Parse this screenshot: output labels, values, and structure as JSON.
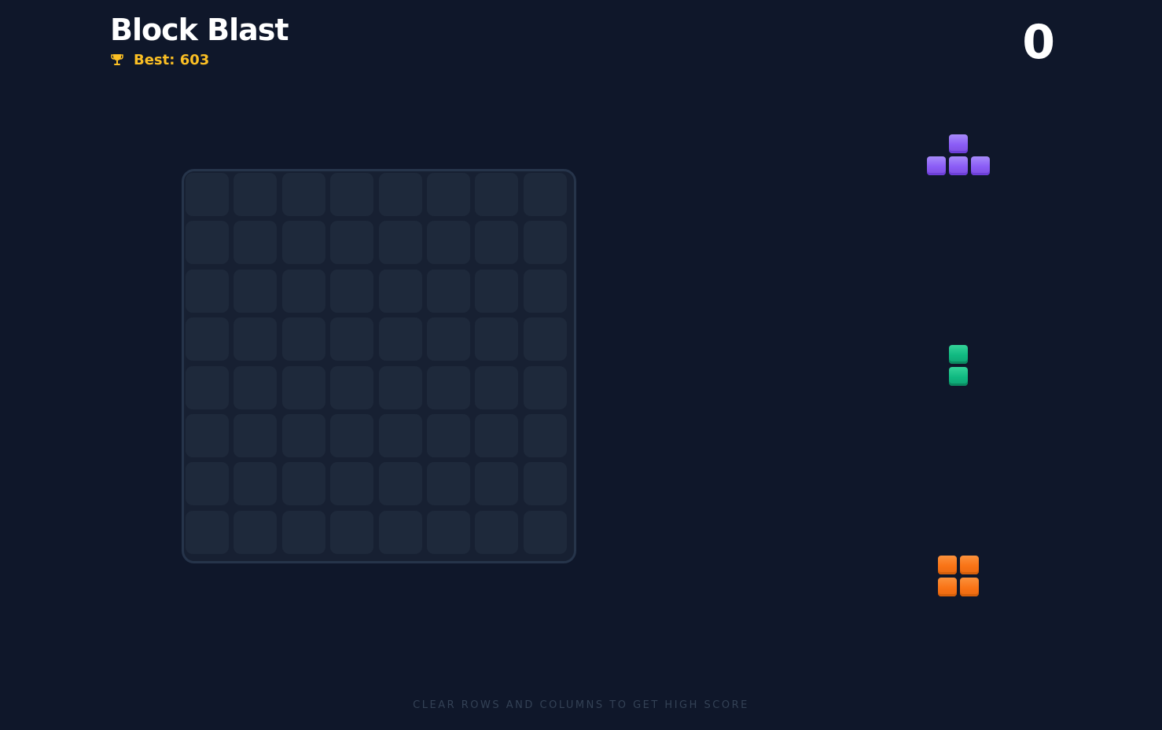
{
  "game": {
    "title": "Block Blast",
    "best_label": "Best: 603",
    "best_value": 603,
    "score": "0",
    "hint": "CLEAR ROWS AND COLUMNS TO GET HIGH SCORE"
  },
  "board": {
    "rows": 8,
    "cols": 8,
    "filled_cells": []
  },
  "pieces": [
    {
      "name": "t-piece",
      "color": "#8b5cf6",
      "cells": [
        [
          0,
          1
        ],
        [
          1,
          0
        ],
        [
          1,
          1
        ],
        [
          1,
          2
        ]
      ]
    },
    {
      "name": "vertical-domino",
      "color": "#10b981",
      "cells": [
        [
          0,
          0
        ],
        [
          1,
          0
        ]
      ]
    },
    {
      "name": "square-piece",
      "color": "#f97316",
      "cells": [
        [
          0,
          0
        ],
        [
          0,
          1
        ],
        [
          1,
          0
        ],
        [
          1,
          1
        ]
      ]
    }
  ],
  "colors": {
    "background": "#0f172a",
    "best": "#fbbf24",
    "cell": "#1e293b"
  },
  "icons": {
    "trophy": "trophy-icon"
  }
}
